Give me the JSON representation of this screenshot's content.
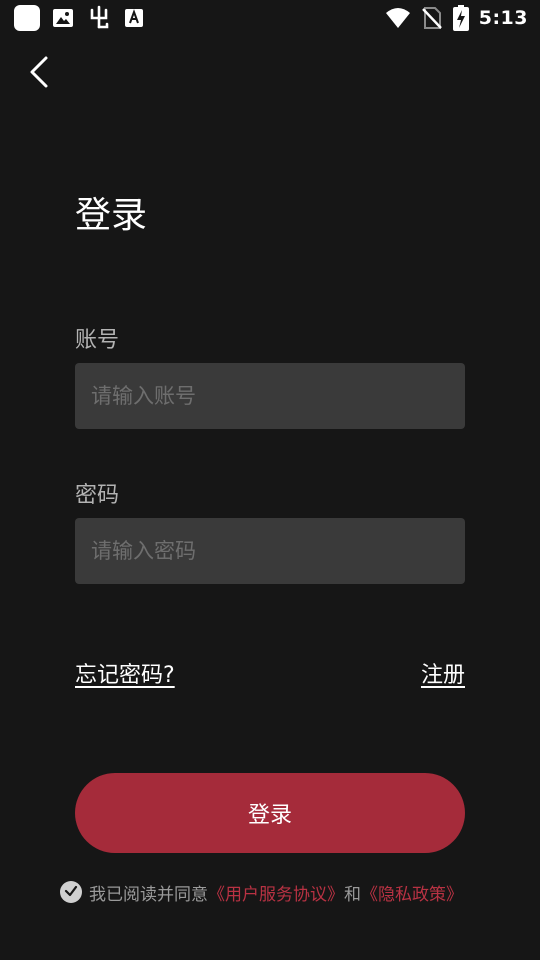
{
  "status_bar": {
    "time": "5:13",
    "left_icons": [
      "app-square-icon",
      "image-icon",
      "bug-icon",
      "font-a-icon"
    ],
    "right_icons": [
      "wifi-icon",
      "no-sim-icon",
      "battery-charging-icon"
    ]
  },
  "nav": {
    "back_icon": "chevron-left-icon"
  },
  "page": {
    "title": "登录"
  },
  "form": {
    "account_label": "账号",
    "account_placeholder": "请输入账号",
    "password_label": "密码",
    "password_placeholder": "请输入密码"
  },
  "links": {
    "forgot": "忘记密码?",
    "register": "注册"
  },
  "login_button": "登录",
  "agreement": {
    "prefix": "我已阅读并同意",
    "user_agreement": "《用户服务协议》",
    "and": "和",
    "privacy_policy": "《隐私政策》",
    "checked": true
  },
  "colors": {
    "background": "#161616",
    "input_bg": "#3a3a3a",
    "accent": "#a52b3a",
    "link_red": "#b83243"
  }
}
